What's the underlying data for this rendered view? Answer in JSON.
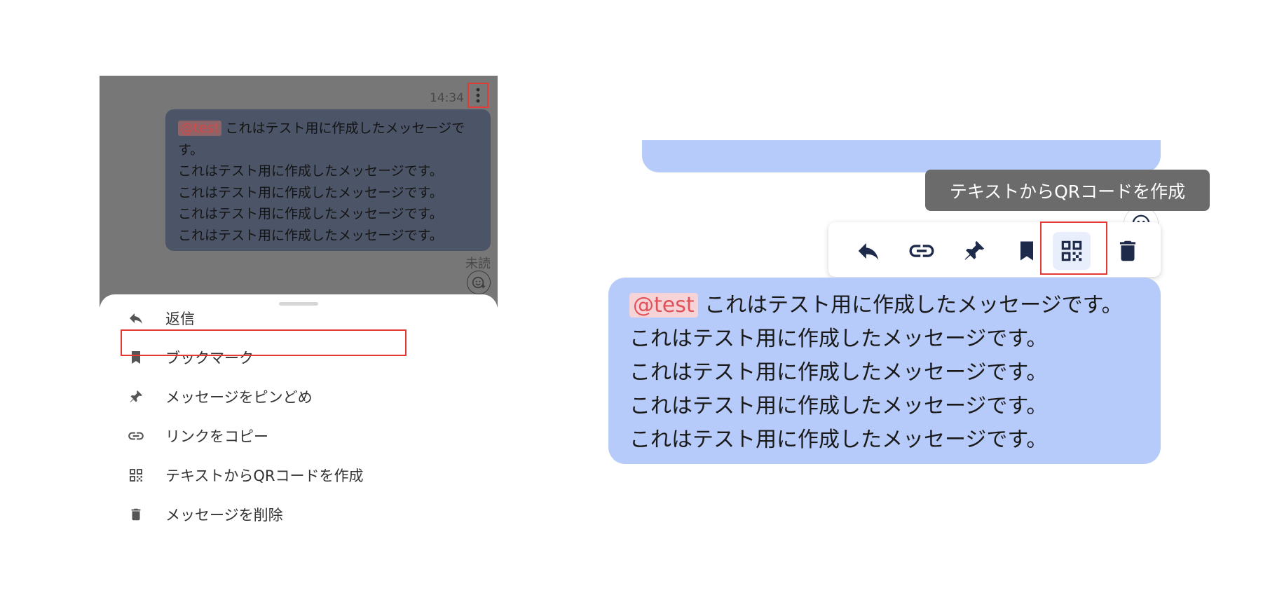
{
  "left": {
    "time": "14:34",
    "message": {
      "mention": "@test",
      "lines": [
        "これはテスト用に作成したメッセージで",
        "す。",
        "これはテスト用に作成したメッセージです。",
        "これはテスト用に作成したメッセージです。",
        "これはテスト用に作成したメッセージです。",
        "これはテスト用に作成したメッセージです。"
      ]
    },
    "unread": "未読",
    "sheet": {
      "items": [
        {
          "label": "返信",
          "icon": "reply-icon"
        },
        {
          "label": "ブックマーク",
          "icon": "bookmark-icon"
        },
        {
          "label": "メッセージをピンどめ",
          "icon": "pin-icon"
        },
        {
          "label": "リンクをコピー",
          "icon": "link-icon"
        },
        {
          "label": "テキストからQRコードを作成",
          "icon": "qr-code-icon"
        },
        {
          "label": "メッセージを削除",
          "icon": "trash-icon"
        }
      ]
    }
  },
  "right": {
    "tooltip": "テキストからQRコードを作成",
    "toolbar": [
      "reply-icon",
      "link-icon",
      "pin-icon",
      "bookmark-icon",
      "qr-code-icon",
      "trash-icon"
    ],
    "message": {
      "mention": "@test",
      "lines": [
        "これはテスト用に作成したメッセージです。",
        "これはテスト用に作成したメッセージです。",
        "これはテスト用に作成したメッセージです。",
        "これはテスト用に作成したメッセージです。",
        "これはテスト用に作成したメッセージです。"
      ]
    }
  },
  "colors": {
    "highlight": "#e53935",
    "bubble_right": "#b7cbfa",
    "icon_dark": "#1e2a4a",
    "overlay": "#777777"
  }
}
